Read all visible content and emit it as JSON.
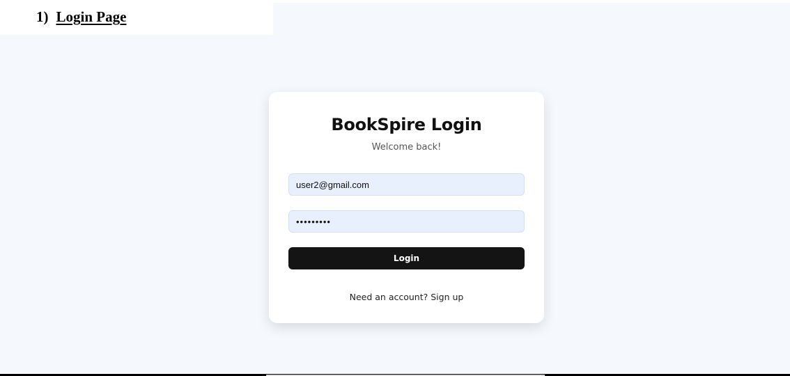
{
  "document": {
    "section_number": "1)",
    "section_title": "Login Page"
  },
  "login_card": {
    "title": "BookSpire Login",
    "subtitle": "Welcome back!",
    "email": {
      "value": "user2@gmail.com"
    },
    "password": {
      "value": "password1"
    },
    "login_label": "Login",
    "signup_prompt": "Need an account?",
    "signup_link": "Sign up"
  },
  "colors": {
    "page_background": "#f5f8fc",
    "card_background": "#ffffff",
    "input_background": "#e8f0fe",
    "button_background": "#141414",
    "button_text": "#ffffff"
  }
}
